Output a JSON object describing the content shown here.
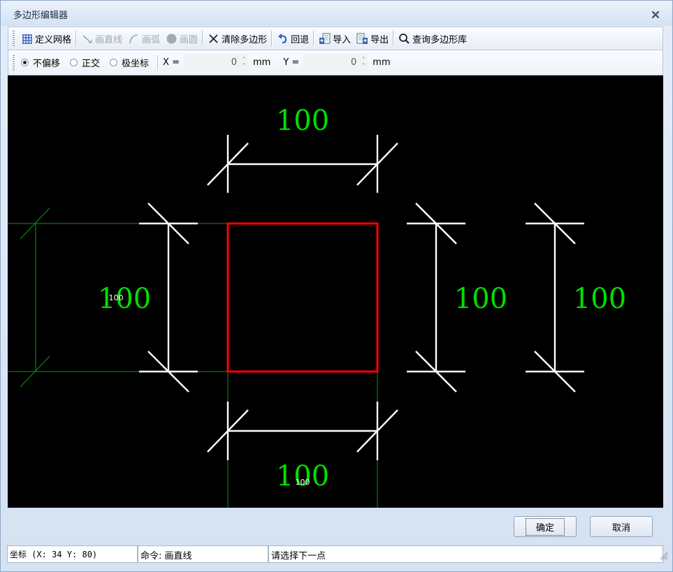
{
  "window": {
    "title": "多边形编辑器"
  },
  "toolbar": {
    "define_grid": "定义网格",
    "draw_line": "画直线",
    "draw_arc": "画弧",
    "draw_circle": "画圆",
    "clear_polygon": "清除多边形",
    "undo": "回退",
    "import": "导入",
    "export": "导出",
    "query_library": "查询多边形库"
  },
  "snap_bar": {
    "modes": [
      {
        "label": "不偏移",
        "selected": true
      },
      {
        "label": "正交",
        "selected": false
      },
      {
        "label": "极坐标",
        "selected": false
      }
    ],
    "x_label": "X =",
    "x_value": "0",
    "x_unit": "mm",
    "y_label": "Y =",
    "y_value": "0",
    "y_unit": "mm"
  },
  "canvas": {
    "background": "#000000",
    "polygon_color": "#ff0000",
    "dimension_color": "#ffffff",
    "label_color": "#00e000",
    "grid_color": "#00a000",
    "dim_top": "100",
    "dim_bottom": "100",
    "dim_left": "100",
    "dim_right1": "100",
    "dim_right2": "100",
    "small_left": "100",
    "small_bottom": "100"
  },
  "buttons": {
    "ok": "确定",
    "cancel": "取消"
  },
  "status": {
    "coords": "坐标 (X: 34 Y: 80)",
    "command": "命令: 画直线",
    "prompt": "请选择下一点"
  }
}
